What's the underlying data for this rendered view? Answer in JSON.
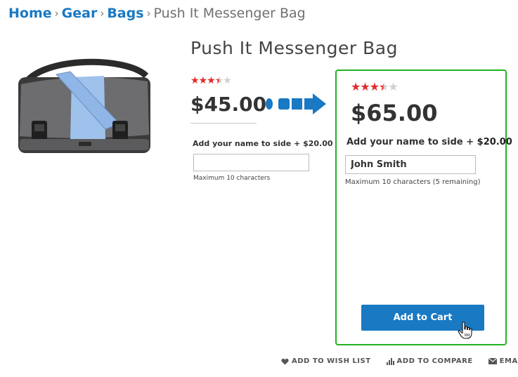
{
  "breadcrumb": {
    "items": [
      "Home",
      "Gear",
      "Bags"
    ],
    "separator": "›",
    "current": "Push It Messenger Bag"
  },
  "product": {
    "title": "Push It Messenger Bag",
    "image_icon": "messenger-bag-photo",
    "rating_stars": 3.5,
    "rating_max": 5
  },
  "before": {
    "price": "$45.00",
    "option_label": "Add your name to side + $20.00",
    "input_value": "",
    "note": "Maximum 10 characters"
  },
  "after": {
    "price": "$65.00",
    "option_label": "Add your name to side +",
    "option_surcharge": "$20.00",
    "input_value": "John Smith",
    "note": "Maximum 10 characters (5 remaining)",
    "add_to_cart_label": "Add to Cart"
  },
  "actions": {
    "wishlist": "ADD TO WISH LIST",
    "compare": "ADD TO COMPARE",
    "email": "EMAIL"
  },
  "colors": {
    "accent": "#1979c3",
    "highlight_border": "#23b323",
    "star": "#e02b27"
  }
}
